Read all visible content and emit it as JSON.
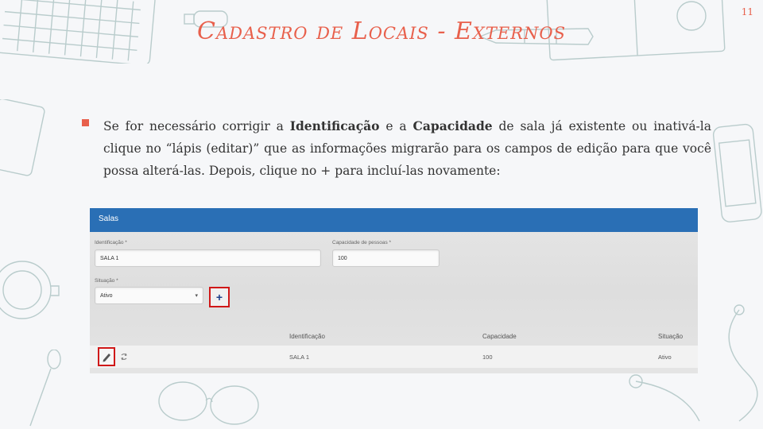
{
  "slide": {
    "title": "Cadastro de Locais - Externos",
    "number": "11"
  },
  "bullet": {
    "t1": "Se for necessário corrigir a ",
    "b1": "Identificação",
    "t2": " e a ",
    "b2": "Capacidade",
    "t3": " de sala já existente ou inativá-la clique no “lápis (editar)” que as informações migrarão para os campos de edição para que você possa alterá-las. Depois, clique no + para incluí-las novamente:"
  },
  "screenshot": {
    "header_title": "Salas",
    "fields": {
      "identificacao_label": "Identificação *",
      "identificacao_value": "SALA 1",
      "capacidade_label": "Capacidade de pessoas *",
      "capacidade_value": "100",
      "situacao_label": "Situação *",
      "situacao_value": "Ativo"
    },
    "add_button_label": "+",
    "table": {
      "columns": [
        "Identificação",
        "Capacidade",
        "Situação"
      ],
      "rows": [
        {
          "identificacao": "SALA 1",
          "capacidade": "100",
          "situacao": "Ativo"
        }
      ]
    }
  },
  "colors": {
    "accent": "#e8604c",
    "header_blue": "#2a6fb5",
    "highlight_red": "#d01818"
  }
}
